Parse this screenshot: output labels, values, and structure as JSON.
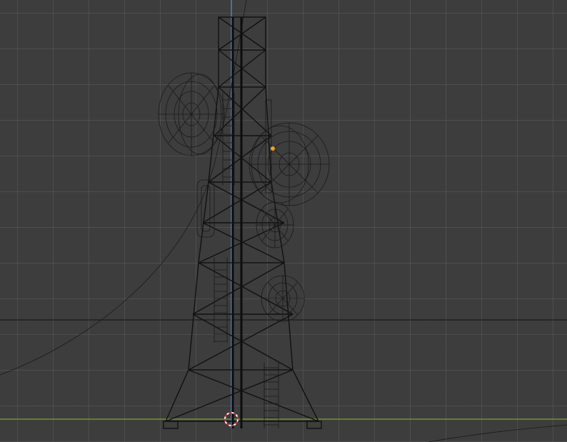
{
  "viewport": {
    "mode": "front-orthographic",
    "shading": "wireframe",
    "colors": {
      "background": "#3d3d3d",
      "grid": "#5a5a5a",
      "x_axis": "#6a9a2a",
      "z_axis": "#4a7fc1",
      "wire": "#111111",
      "origin": "#f0a020",
      "cursor_red": "#c83232",
      "cursor_white": "#ffffff"
    },
    "objects": [
      {
        "name": "tower-lattice",
        "icon": "wireframe-mesh"
      },
      {
        "name": "dish-antennas",
        "icon": "wireframe-mesh"
      },
      {
        "name": "ladders",
        "icon": "wireframe-mesh"
      },
      {
        "name": "cable-curve",
        "icon": "curve"
      }
    ]
  }
}
